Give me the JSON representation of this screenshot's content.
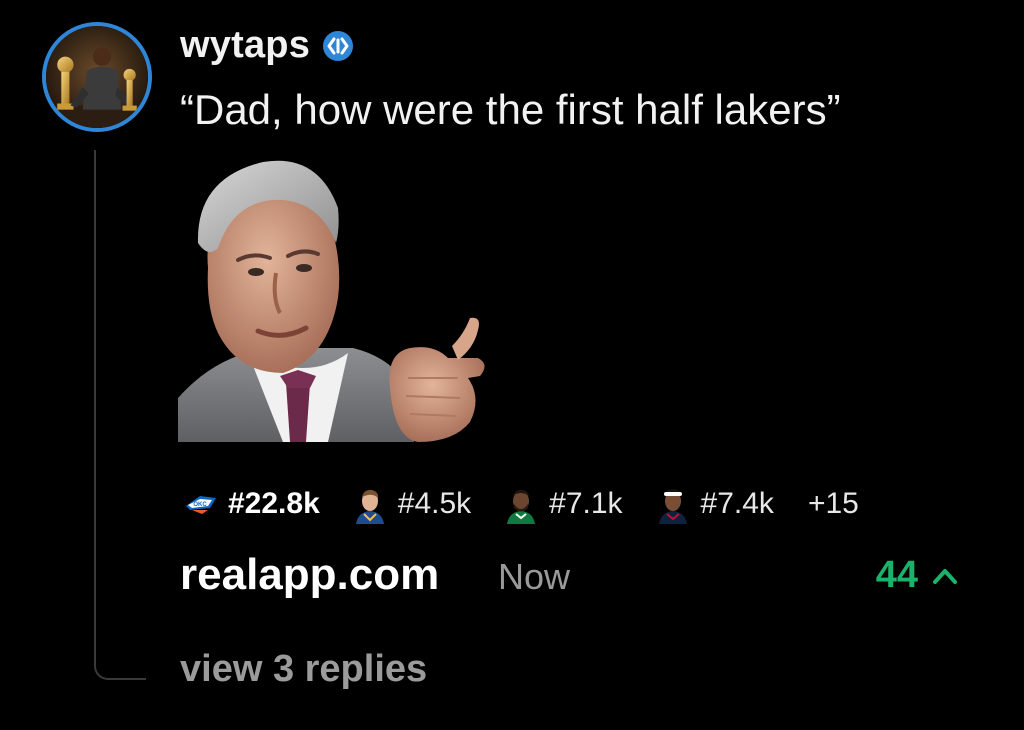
{
  "comment": {
    "username": "wytaps",
    "verified_icon": "verified-badge-icon",
    "avatar_icon": "avatar-trophies-image",
    "text": "“Dad, how were the first half lakers”",
    "image": "meme-man-thumb-gesture"
  },
  "ranks": {
    "items": [
      {
        "icon": "thunder-team-logo-icon",
        "label": "#22.8k"
      },
      {
        "icon": "player-avatar-icon",
        "label": "#4.5k"
      },
      {
        "icon": "player-avatar-icon",
        "label": "#7.1k"
      },
      {
        "icon": "player-avatar-icon",
        "label": "#7.4k"
      }
    ],
    "more": "+15"
  },
  "footer": {
    "site": "realapp.com",
    "time": "Now",
    "upvotes": "44",
    "upvote_color": "#19b36b"
  },
  "replies": {
    "label": "view 3 replies"
  }
}
